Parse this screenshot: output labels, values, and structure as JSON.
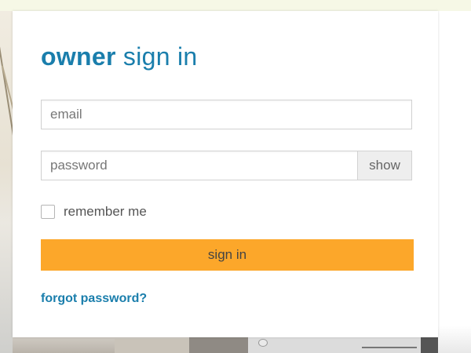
{
  "login": {
    "title_strong": "owner",
    "title_rest": " sign in",
    "email": {
      "placeholder": "email",
      "value": ""
    },
    "password": {
      "placeholder": "password",
      "value": "",
      "toggle_label": "show"
    },
    "remember_label": "remember me",
    "remember_checked": false,
    "submit_label": "sign in",
    "forgot_label": "forgot password?"
  },
  "colors": {
    "brand_blue": "#1a7eac",
    "button_orange": "#fca72a",
    "top_strip": "#f6f8e6"
  }
}
